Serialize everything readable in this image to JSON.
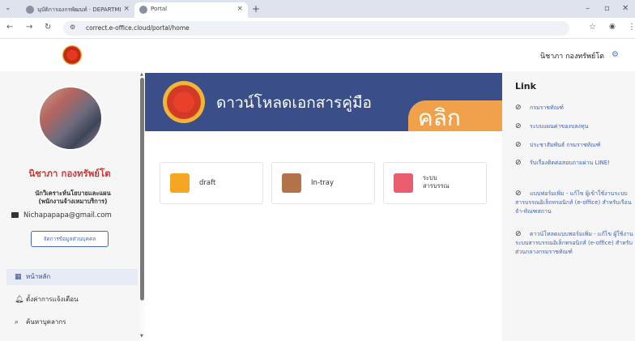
{
  "browser": {
    "tabs": [
      {
        "title": "นุบัดิการองกรพัฒนท์ · DEPARTMI",
        "active": false
      },
      {
        "title": "Portal",
        "active": true
      }
    ],
    "url": "correct.e-office.cloud/portal/home",
    "menu_icon": "chevron-down-icon",
    "newtab_icon": "plus-icon"
  },
  "header": {
    "user_name": "นิชาภา กองทรัพย์โต"
  },
  "sidebar": {
    "profile_name": "นิชาภา กองทรัพย์โต",
    "role_line1": "นักวิเคราะห์นโยบายและแผน",
    "role_line2": "(พนักงานจ้างเหมาบริการ)",
    "email": "Nichapapapa@gmail.com",
    "manage_label": "จัดการข้อมูลส่วนบุคคล",
    "menu": [
      {
        "label": "หน้าหลัก",
        "icon": "grid-icon",
        "active": true
      },
      {
        "label": "ตั้งค่าการแจ้งเตือน",
        "icon": "bell-icon",
        "active": false
      },
      {
        "label": "ค้นหาบุคลากร",
        "icon": "search-icon",
        "active": false
      }
    ]
  },
  "main": {
    "banner_title": "ดาวน์โหลดเอกสารคู่มือ",
    "banner_cta": "คลิก",
    "cards": [
      {
        "label": "draft",
        "icon": "draft-icon",
        "color": "#f5a623"
      },
      {
        "label": "In-tray",
        "icon": "in-tray-icon",
        "color": "#b3734b"
      },
      {
        "label_line1": "ระบบ",
        "label_line2": "สารบรรณ",
        "icon": "document-icon",
        "color": "#ea5d6f"
      }
    ]
  },
  "right_panel": {
    "title": "Link",
    "links": [
      "กรมราชทัณฑ์",
      "ระบบแผนค่าของบลงทุน",
      "ประชาสัมพันธ์ กรมราชทัณฑ์",
      "รับเรื่องติดต่อสอบถามผ่าน LINE!",
      "แบบฟอร์มเพิ่ม - แก้ไข ผู้เข้าใช้งานระบบสารบรรณอิเล็กทรอนิกส์ (e-office) สำหรับเรือนจำ-ทัณฑสถาน",
      "ดาวน์โหลดแบบฟอร์มเพิ่ม - แก้ไข ผู้ใช้งานระบบสารบรรณอิเล็กทรอนิกส์ (e-office) สำหรับส่วนกลางกรมราชทัณฑ์"
    ]
  },
  "colors": {
    "banner_bg": "#3a4e8a",
    "banner_cta_bg": "#f1a14a",
    "profile_name": "#c83a3a",
    "link": "#3e62b2",
    "accent_blue": "#4a68b0"
  }
}
